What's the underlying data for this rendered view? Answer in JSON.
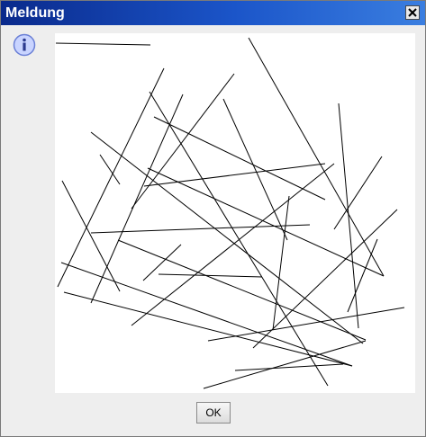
{
  "dialog": {
    "title": "Meldung",
    "close_icon": "close-icon",
    "message_icon": "info-icon",
    "ok_label": "OK"
  },
  "colors": {
    "titlebar_start": "#0a2a8c",
    "titlebar_end": "#3a7ee0",
    "dialog_bg": "#eeeeee",
    "canvas_bg": "#ffffff",
    "line_color": "#000000",
    "info_icon_fill": "#c9d4ff",
    "info_icon_stroke": "#6a7fd6"
  }
}
